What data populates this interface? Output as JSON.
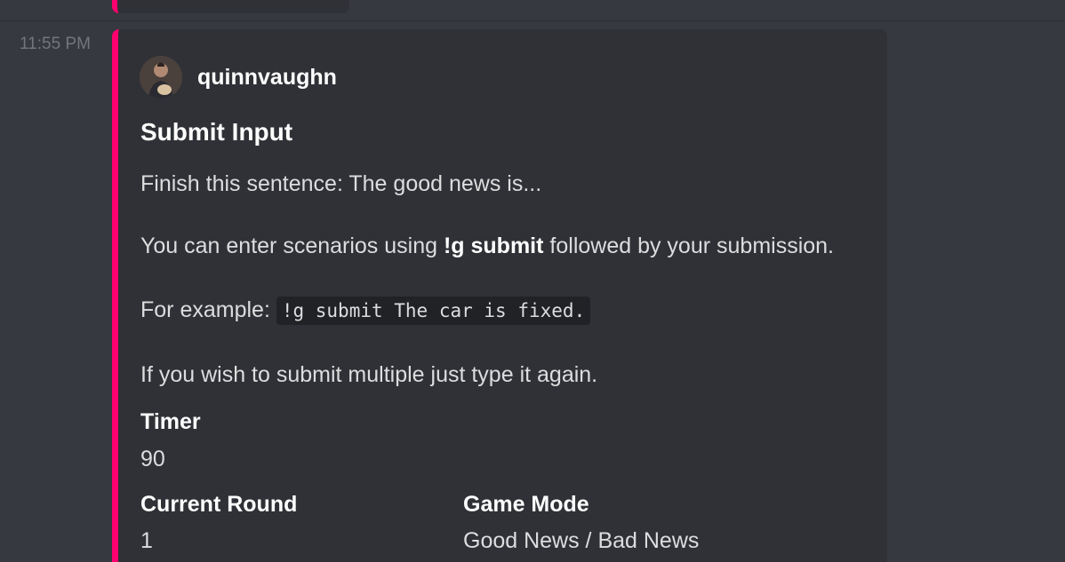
{
  "message": {
    "timestamp": "11:55 PM"
  },
  "embed": {
    "accent_color": "#ff006e",
    "author": {
      "name": "quinnvaughn"
    },
    "title": "Submit Input",
    "description": {
      "line1": "Finish this sentence: The good news is...",
      "line2_prefix": "You can enter scenarios using ",
      "line2_bold": "!g submit",
      "line2_suffix": " followed by your submission.",
      "line3_prefix": "For example: ",
      "line3_code": "!g submit The car is fixed.",
      "line4": "If you wish to submit multiple just type it again."
    },
    "fields": {
      "timer": {
        "name": "Timer",
        "value": "90"
      },
      "current_round": {
        "name": "Current Round",
        "value": "1"
      },
      "game_mode": {
        "name": "Game Mode",
        "value": "Good News / Bad News"
      }
    }
  }
}
